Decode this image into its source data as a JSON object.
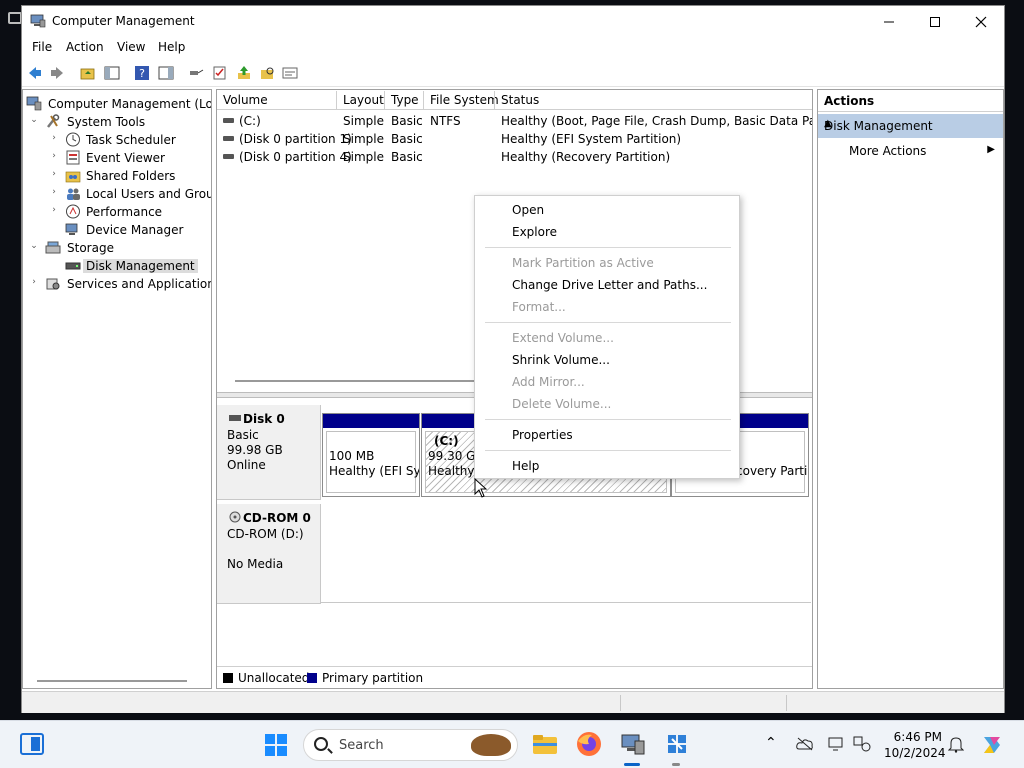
{
  "window": {
    "title": "Computer Management"
  },
  "menu": {
    "file": "File",
    "action": "Action",
    "view": "View",
    "help": "Help"
  },
  "tree": {
    "root": "Computer Management (Local",
    "system_tools": "System Tools",
    "task_scheduler": "Task Scheduler",
    "event_viewer": "Event Viewer",
    "shared_folders": "Shared Folders",
    "local_users": "Local Users and Groups",
    "performance": "Performance",
    "device_manager": "Device Manager",
    "storage": "Storage",
    "disk_management": "Disk Management",
    "services": "Services and Applications"
  },
  "volume_list": {
    "headers": {
      "volume": "Volume",
      "layout": "Layout",
      "type": "Type",
      "fs": "File System",
      "status": "Status"
    },
    "rows": [
      {
        "volume": "(C:)",
        "layout": "Simple",
        "type": "Basic",
        "fs": "NTFS",
        "status": "Healthy (Boot, Page File, Crash Dump, Basic Data Partition)"
      },
      {
        "volume": "(Disk 0 partition 1)",
        "layout": "Simple",
        "type": "Basic",
        "fs": "",
        "status": "Healthy (EFI System Partition)"
      },
      {
        "volume": "(Disk 0 partition 4)",
        "layout": "Simple",
        "type": "Basic",
        "fs": "",
        "status": "Healthy (Recovery Partition)"
      }
    ]
  },
  "disk0": {
    "name": "Disk 0",
    "kind": "Basic",
    "size": "99.98 GB",
    "state": "Online",
    "partitions": {
      "efi": {
        "size": "100 MB",
        "status": "Healthy (EFI Sys"
      },
      "c": {
        "name": "(C:)",
        "size": "99.30 GB",
        "status": "Healthy ("
      },
      "recovery": {
        "status": "covery Parti"
      }
    }
  },
  "cdrom0": {
    "name": "CD-ROM 0",
    "kind": "CD-ROM (D:)",
    "media": "No Media"
  },
  "legend": {
    "unallocated": "Unallocated",
    "primary": "Primary partition",
    "unallocated_color": "#000000",
    "primary_color": "#00008b"
  },
  "actions": {
    "header": "Actions",
    "section": "Disk Management",
    "more": "More Actions"
  },
  "context_menu": {
    "open": "Open",
    "explore": "Explore",
    "mark_active": "Mark Partition as Active",
    "change_letter": "Change Drive Letter and Paths...",
    "format": "Format...",
    "extend": "Extend Volume...",
    "shrink": "Shrink Volume...",
    "add_mirror": "Add Mirror...",
    "delete": "Delete Volume...",
    "properties": "Properties",
    "help": "Help"
  },
  "taskbar": {
    "search_placeholder": "Search",
    "time": "6:46 PM",
    "date": "10/2/2024"
  }
}
